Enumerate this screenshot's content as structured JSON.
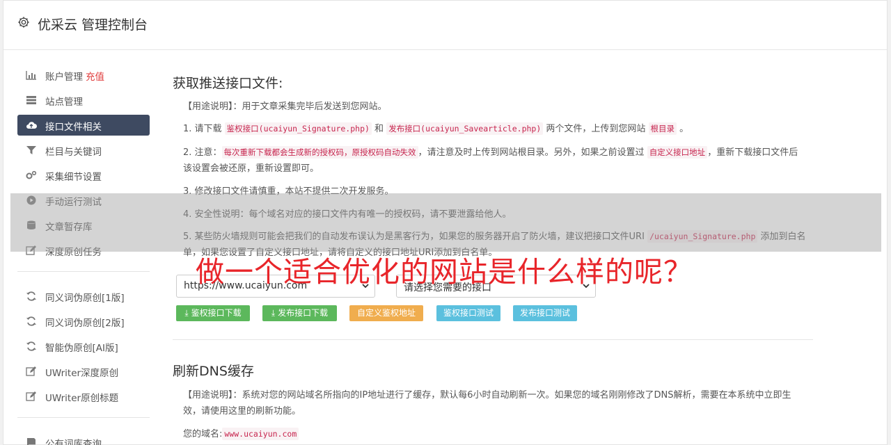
{
  "app": {
    "title": "优采云 管理控制台"
  },
  "sidebar": {
    "items": [
      {
        "label": "账户管理",
        "extra": "充值",
        "icon": "bar-chart-icon"
      },
      {
        "label": "站点管理",
        "icon": "server-icon"
      },
      {
        "label": "接口文件相关",
        "icon": "cloud-upload-icon",
        "active": true
      },
      {
        "label": "栏目与关键词",
        "icon": "filter-icon"
      },
      {
        "label": "采集细节设置",
        "icon": "cogs-icon"
      },
      {
        "label": "手动运行测试",
        "icon": "play-circle-icon"
      },
      {
        "label": "文章暂存库",
        "icon": "database-icon"
      },
      {
        "label": "深度原创任务",
        "icon": "edit-icon"
      },
      {
        "label": "同义词伪原创[1版]",
        "icon": "refresh-icon"
      },
      {
        "label": "同义词伪原创[2版]",
        "icon": "refresh-icon"
      },
      {
        "label": "智能伪原创[AI版]",
        "icon": "refresh-icon"
      },
      {
        "label": "UWriter深度原创",
        "icon": "edit-icon"
      },
      {
        "label": "UWriter原创标题",
        "icon": "edit-icon"
      },
      {
        "label": "公有词库查询",
        "icon": "book-icon"
      }
    ]
  },
  "section1": {
    "title": "获取推送接口文件:",
    "usage_tag": "【用途说明】",
    "usage_text": "：用于文章采集完毕后发送到您网站。",
    "step1_a": "1. 请下载 ",
    "step1_code1": "鉴权接口(ucaiyun_Signature.php)",
    "step1_b": " 和 ",
    "step1_code2": "发布接口(ucaiyun_Savearticle.php)",
    "step1_c": " 两个文件，上传到您网站 ",
    "step1_code3": "根目录",
    "step1_d": " 。",
    "step2_a": "2. 注意：",
    "step2_code1": "每次重新下载都会生成新的授权码，原授权码自动失效",
    "step2_b": "，请注意及时上传到网站根目录。另外，如果之前设置过 ",
    "step2_code2": "自定义接口地址",
    "step2_c": "，重新下载接口文件后该设置会被还原，重新设置即可。",
    "step3": "3. 修改接口文件请慎重，本站不提供二次开发服务。",
    "step4": "4. 安全性说明：每个域名对应的接口文件内有唯一的授权码，请不要泄露给他人。",
    "step5_a": "5. 某些防火墙规则可能会把我们的自动发布误认为是黑客行为，如果您的服务器开启了防火墙，建议把接口文件URI ",
    "step5_code": "/ucaiyun_Signature.php",
    "step5_b": " 添加到白名单，如果您设置了自定义接口地址，请将自定义的接口地址URI添加到白名单。",
    "site_select": "https://www.ucaiyun.com",
    "api_select": "请选择您需要的接口",
    "buttons": {
      "download_sign": "鉴权接口下载",
      "download_publish": "发布接口下载",
      "custom_auth": "自定义鉴权地址",
      "test_sign": "鉴权接口测试",
      "test_publish": "发布接口测试"
    }
  },
  "section2": {
    "title": "刷新DNS缓存",
    "usage_tag": "【用途说明】",
    "usage_text": "：系统对您的网站域名所指向的IP地址进行了缓存，默认每6小时自动刷新一次。如果您的域名刚刚修改了DNS解析，需要在本系统中立即生效，请使用这里的刷新功能。",
    "domain_label": "您的域名:",
    "domain_value": "www.ucaiyun.com"
  },
  "overlay": {
    "headline": "做一个适合优化的网站是什么样的呢？"
  },
  "colors": {
    "green": "#5cb85c",
    "orange": "#f0ad4e",
    "blue": "#5bc0de",
    "active_nav": "#3e4a61",
    "headline": "#e8252a"
  }
}
